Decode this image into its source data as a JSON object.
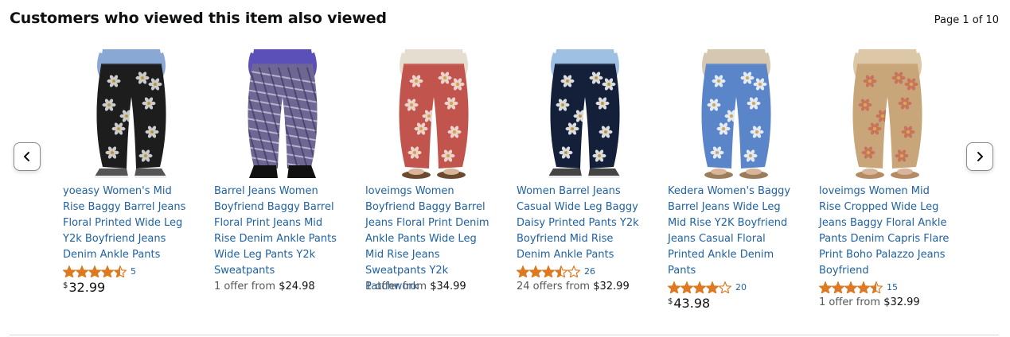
{
  "header": {
    "title": "Customers who viewed this item also viewed",
    "pager": "Page 1 of 10"
  },
  "nav": {
    "prev_icon": "chevron-left-icon",
    "next_icon": "chevron-right-icon"
  },
  "colors": {
    "link": "#2162a1",
    "star": "#de7921",
    "border": "#888c8c"
  },
  "products": [
    {
      "title": "yoeasy Women's Mid Rise Baggy Barrel Jeans Floral Printed Wide Leg Y2k Boyfriend Jeans Denim Ankle Pants",
      "rating": 4.5,
      "rating_count": "5",
      "price_symbol": "$",
      "price": "32.99",
      "offer_prefix": "",
      "offer_price": "",
      "image": "black-floral-barrel-jeans"
    },
    {
      "title": "Barrel Jeans Women Boyfriend Baggy Barrel Floral Print Jeans Mid Rise Denim Ankle Pants Wide Leg Pants Y2k Sweatpants",
      "rating": null,
      "rating_count": "",
      "price_symbol": "",
      "price": "",
      "offer_prefix": "1 offer from",
      "offer_price": "$24.98",
      "image": "plaid-barrel-pants"
    },
    {
      "title": "loveimgs Women Boyfriend Baggy Barrel Jeans Floral Print Denim Ankle Pants Wide Leg Mid Rise Jeans Sweatpants Y2k Patchwork",
      "rating": null,
      "rating_count": "",
      "price_symbol": "",
      "price": "",
      "offer_prefix": "1 offer from",
      "offer_price": "$34.99",
      "image": "red-bandana-print-jeans"
    },
    {
      "title": "Women Barrel Jeans Casual Wide Leg Baggy Daisy Printed Pants Y2k Boyfriend Mid Rise Denim Ankle Pants",
      "rating": 3.5,
      "rating_count": "26",
      "price_symbol": "",
      "price": "",
      "offer_prefix": "24 offers from",
      "offer_price": "$32.99",
      "image": "navy-daisy-barrel-jeans"
    },
    {
      "title": "Kedera Women's Baggy Barrel Jeans Wide Leg Mid Rise Y2K Boyfriend Jeans Casual Floral Printed Ankle Denim Pants",
      "rating": 4.0,
      "rating_count": "20",
      "price_symbol": "$",
      "price": "43.98",
      "offer_prefix": "",
      "offer_price": "",
      "image": "blue-floral-barrel-jeans"
    },
    {
      "title": "loveimgs Women Mid Rise Cropped Wide Leg Jeans Baggy Floral Ankle Pants Denim Capris Flare Print Boho Palazzo Jeans Boyfriend",
      "rating": 4.5,
      "rating_count": "15",
      "price_symbol": "",
      "price": "",
      "offer_prefix": "1 offer from",
      "offer_price": "$32.99",
      "image": "beige-floral-wide-leg-jeans"
    }
  ]
}
